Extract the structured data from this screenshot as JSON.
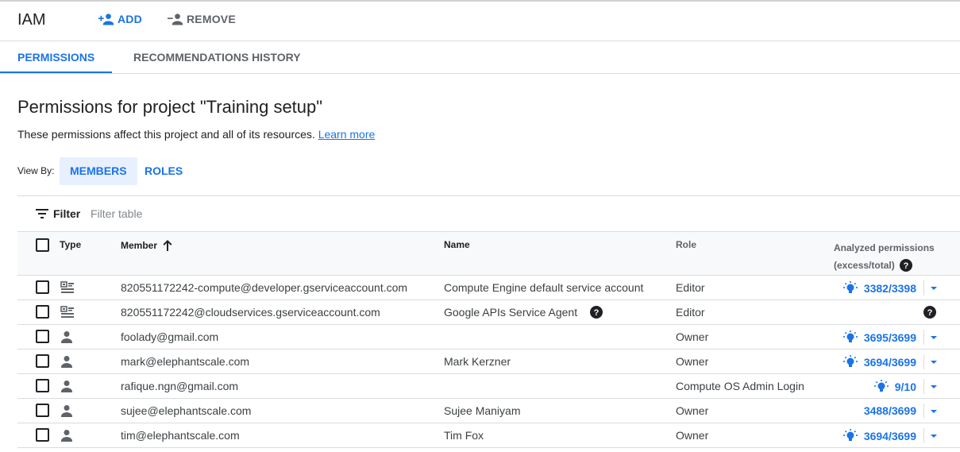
{
  "header": {
    "title": "IAM",
    "add_label": "ADD",
    "remove_label": "REMOVE"
  },
  "tabs": [
    {
      "label": "PERMISSIONS",
      "active": true
    },
    {
      "label": "RECOMMENDATIONS HISTORY",
      "active": false
    }
  ],
  "page": {
    "title": "Permissions for project \"Training setup\"",
    "description": "These permissions affect this project and all of its resources.",
    "learn_more": "Learn more"
  },
  "view_by": {
    "label": "View By:",
    "members": "MEMBERS",
    "roles": "ROLES",
    "selected": "MEMBERS"
  },
  "filter": {
    "label": "Filter",
    "placeholder": "Filter table"
  },
  "table": {
    "columns": {
      "type": "Type",
      "member": "Member",
      "name": "Name",
      "role": "Role",
      "analyzed_line1": "Analyzed permissions",
      "analyzed_line2": "(excess/total)"
    },
    "sort": {
      "column": "member",
      "direction": "ascending"
    },
    "rows": [
      {
        "type_icon": "service-account-icon",
        "member": "820551172242-compute@developer.gserviceaccount.com",
        "name": "Compute Engine default service account",
        "role": "Editor",
        "analyzed": "3382/3398",
        "recommendation": true,
        "dropdown": true,
        "name_help": false
      },
      {
        "type_icon": "service-account-icon",
        "member": "820551172242@cloudservices.gserviceaccount.com",
        "name": "Google APIs Service Agent",
        "role": "Editor",
        "analyzed": "",
        "recommendation": false,
        "dropdown": false,
        "name_help": true
      },
      {
        "type_icon": "person-icon",
        "member": "foolady@gmail.com",
        "name": "",
        "role": "Owner",
        "analyzed": "3695/3699",
        "recommendation": true,
        "dropdown": true,
        "name_help": false
      },
      {
        "type_icon": "person-icon",
        "member": "mark@elephantscale.com",
        "name": "Mark Kerzner",
        "role": "Owner",
        "analyzed": "3694/3699",
        "recommendation": true,
        "dropdown": true,
        "name_help": false
      },
      {
        "type_icon": "person-icon",
        "member": "rafique.ngn@gmail.com",
        "name": "",
        "role": "Compute OS Admin Login",
        "analyzed": "9/10",
        "recommendation": true,
        "dropdown": true,
        "name_help": false
      },
      {
        "type_icon": "person-icon",
        "member": "sujee@elephantscale.com",
        "name": "Sujee Maniyam",
        "role": "Owner",
        "analyzed": "3488/3699",
        "recommendation": false,
        "dropdown": true,
        "name_help": false
      },
      {
        "type_icon": "person-icon",
        "member": "tim@elephantscale.com",
        "name": "Tim Fox",
        "role": "Owner",
        "analyzed": "3694/3699",
        "recommendation": true,
        "dropdown": true,
        "name_help": false
      }
    ]
  },
  "colors": {
    "accent": "#1a73e8",
    "text": "#202124",
    "muted": "#5f6368",
    "divider": "#dadce0",
    "selected_bg": "#e8f0fe"
  }
}
